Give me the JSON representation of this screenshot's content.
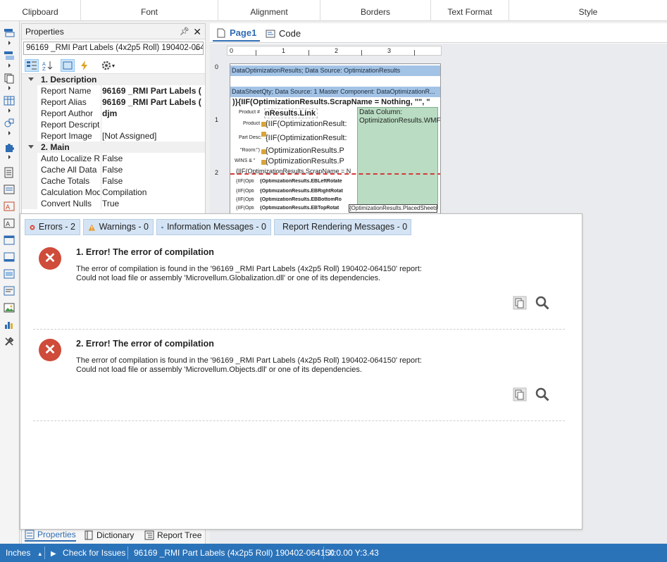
{
  "ribbon": {
    "groups": [
      "Clipboard",
      "Font",
      "Alignment",
      "Borders",
      "Text Format",
      "Style"
    ]
  },
  "properties_panel": {
    "title": "Properties",
    "component_select": "96169 _RMI Part Labels (4x2p5 Roll) 190402-064",
    "categories": [
      {
        "label": "1. Description",
        "rows": [
          {
            "name": "Report Name",
            "value": "96169 _RMI Part Labels (",
            "bold": true
          },
          {
            "name": "Report Alias",
            "value": "96169 _RMI Part Labels (",
            "bold": true
          },
          {
            "name": "Report Author",
            "value": "djm",
            "bold": true
          },
          {
            "name": "Report Descriptio",
            "value": "",
            "bold": false
          },
          {
            "name": "Report Image",
            "value": "[Not Assigned]",
            "bold": false
          }
        ]
      },
      {
        "label": "2. Main",
        "rows": [
          {
            "name": "Auto Localize Re",
            "value": "False",
            "bold": false
          },
          {
            "name": "Cache All Data",
            "value": "False",
            "bold": false
          },
          {
            "name": "Cache Totals",
            "value": "False",
            "bold": false
          },
          {
            "name": "Calculation Mode",
            "value": "Compilation",
            "bold": false
          },
          {
            "name": "Convert Nulls",
            "value": "True",
            "bold": false
          }
        ]
      }
    ],
    "bottom_tabs": [
      "Properties",
      "Dictionary",
      "Report Tree"
    ]
  },
  "designer": {
    "tabs": [
      "Page1",
      "Code"
    ],
    "ruler_h": [
      "0",
      "1",
      "2",
      "3"
    ],
    "ruler_v": [
      "0",
      "1",
      "2"
    ],
    "band_data": "DataOptimizationResults; Data Source: OptimizationResults",
    "band_sheet": "DataSheetQty; Data Source: 1    Master Component: DataOptimizationR...",
    "fields": {
      "iif_top": ")}{IIF(OptimizationResults.ScrapName = Nothing, \"\", \"",
      "link": "nResults.Link",
      "product_label": "Product #",
      "iif1": "{IIF(OptimizationResult:",
      "product2": "Product :",
      "part_desc": "Part Desc:",
      "iif2": "{IIF(OptimizationResult:",
      "room": "\"Room:\")",
      "opt_p1": "{OptimizationResults.P",
      "wins": "WINS & \" ",
      "opt_p2": "{OptimizationResults.P",
      "iif_scrap": "{IIF(OptimizationResults.ScrapName = N",
      "iif_a": "{IIF(Opti",
      "eb_left": "{OptimizationResults.EBLeftRotate",
      "iif_b": "{IIF(Opti",
      "eb_right": "{OptimizationResults.EBRightRotat",
      "iif_c": "{IIF(Opti",
      "eb_bottom": "{OptimizationResults.EBBottomRo",
      "iif_d": "{IIF(Opti",
      "eb_top": "{OptimizationResults.EBTopRotat",
      "placed": "{OptimizationResults.PlacedSheets",
      "green": "Data Column: OptimizationResults.WMFStream"
    }
  },
  "error_window": {
    "tabs": [
      {
        "label": "Errors - 2",
        "icon": "error-icon"
      },
      {
        "label": "Warnings - 0",
        "icon": "warning-icon"
      },
      {
        "label": "Information Messages - 0",
        "icon": "info-icon"
      },
      {
        "label": "Report Rendering Messages - 0",
        "icon": "rendering-info-icon"
      }
    ],
    "items": [
      {
        "title": "1. Error! The error of compilation",
        "message": "The error of compilation is found in the '96169 _RMI Part Labels (4x2p5 Roll) 190402-064150' report:\nCould not load file or assembly 'Microvellum.Globalization.dll' or one of its dependencies."
      },
      {
        "title": "2. Error! The error of compilation",
        "message": "The error of compilation is found in the '96169 _RMI Part Labels (4x2p5 Roll) 190402-064150' report:\nCould not load file or assembly 'Microvellum.Objects.dll' or one of its dependencies."
      }
    ]
  },
  "status_bar": {
    "units": "Inches",
    "check": "Check for Issues",
    "report": "96169 _RMI Part Labels (4x2p5 Roll) 190402-064150",
    "coords": "X:0.00 Y:3.43"
  },
  "colors": {
    "status_bar": "#2b73b9",
    "error_icon": "#cf4b3a",
    "band": "#a3c3e6",
    "tab_bg": "#d4e4f4"
  }
}
